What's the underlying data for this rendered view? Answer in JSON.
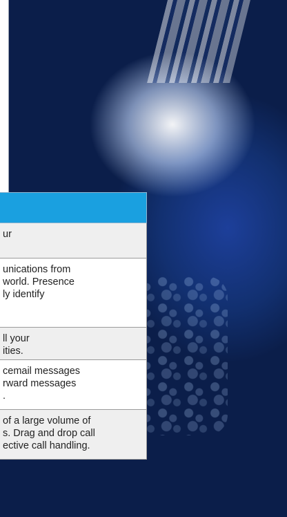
{
  "rows": [
    {
      "lines": [
        "ur",
        ""
      ]
    },
    {
      "lines": [
        "unications from",
        "world. Presence",
        "ly identify",
        ""
      ]
    },
    {
      "lines": [
        "ll your",
        "ities."
      ]
    },
    {
      "lines": [
        "cemail messages",
        "rward messages",
        "."
      ]
    },
    {
      "lines": [
        " of a large volume of",
        "s. Drag and drop call",
        "ective call handling."
      ]
    }
  ]
}
